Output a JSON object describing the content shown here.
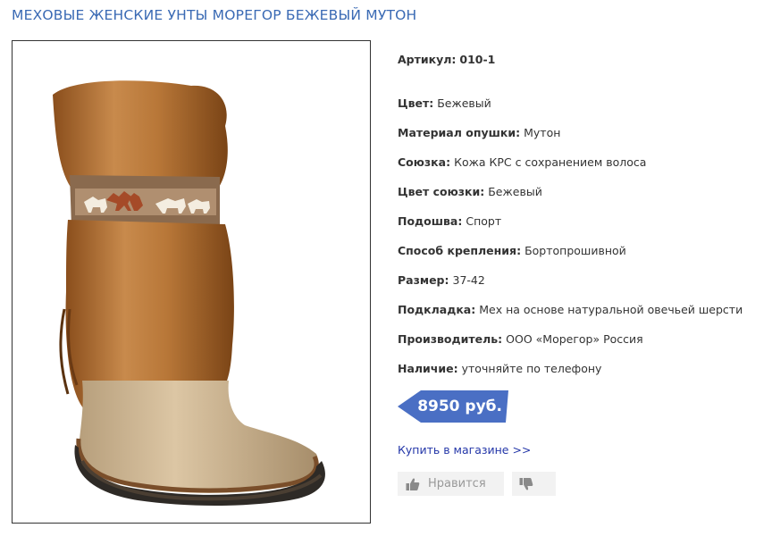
{
  "page": {
    "title": "МЕХОВЫЕ ЖЕНСКИЕ УНТЫ МОРЕГОР БЕЖЕВЫЙ МУТОН"
  },
  "product": {
    "image_icon": "fur-boot-photo",
    "specs": [
      {
        "key": "Артикул:",
        "value": "010-1",
        "value_bold": true
      },
      {
        "key": "Цвет:",
        "value": "Бежевый"
      },
      {
        "key": "Материал опушки:",
        "value": "Мутон"
      },
      {
        "key": "Союзка:",
        "value": "Кожа КРС с сохранением волоса"
      },
      {
        "key": "Цвет союзки:",
        "value": "Бежевый"
      },
      {
        "key": "Подошва:",
        "value": "Спорт"
      },
      {
        "key": "Способ крепления:",
        "value": "Бортопрошивной"
      },
      {
        "key": "Размер:",
        "value": "37-42"
      },
      {
        "key": "Подкладка:",
        "value": "Мех на основе натуральной овечьей шерсти"
      },
      {
        "key": "Производитель:",
        "value": "ООО «Морегор» Россия"
      },
      {
        "key": "Наличие:",
        "value": "уточняйте по телефону"
      }
    ],
    "price": "8950 руб.",
    "buy_link": "Купить в магазине >>",
    "like_label": "Нравится"
  },
  "colors": {
    "title": "#3a6ab4",
    "price_bg": "#4a6fc4",
    "link": "#2336a8"
  }
}
